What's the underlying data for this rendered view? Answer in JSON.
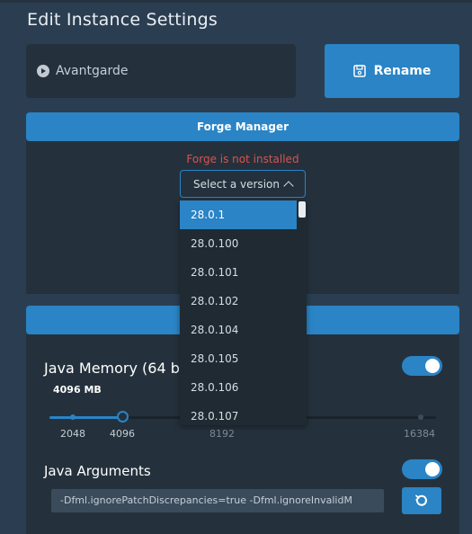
{
  "title": "Edit Instance Settings",
  "instance": {
    "name": "Avantgarde"
  },
  "rename_button": {
    "label": "Rename"
  },
  "forge": {
    "header": "Forge Manager",
    "status": "Forge is not installed",
    "select_placeholder": "Select a version",
    "versions": [
      "28.0.1",
      "28.0.100",
      "28.0.101",
      "28.0.102",
      "28.0.104",
      "28.0.105",
      "28.0.106",
      "28.0.107"
    ],
    "selected_version": "28.0.1"
  },
  "java": {
    "memory_label": "Java Memory (64 bi",
    "memory_value": "4096 MB",
    "memory_mb": 4096,
    "memory_min_mb": 2048,
    "memory_max_mb": 16384,
    "tick_labels": [
      "2048",
      "4096",
      "8192",
      "16384"
    ],
    "memory_toggle_on": true,
    "args_label": "Java Arguments",
    "args_value": "-Dfml.ignorePatchDiscrepancies=true -Dfml.ignoreInvalidM",
    "args_toggle_on": true
  },
  "colors": {
    "accent": "#2a84c5",
    "background": "#2b3e51",
    "panel": "#24313c",
    "error": "#d9534f"
  }
}
